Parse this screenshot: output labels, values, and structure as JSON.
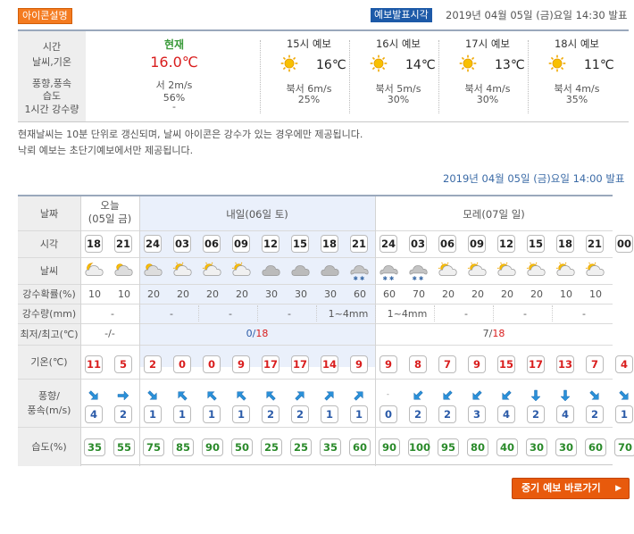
{
  "header": {
    "icon_label": "아이콘설명",
    "pub_label": "예보발표시각",
    "pub_time": "2019년 04월 05일 (금)요일 14:30 발표"
  },
  "current": {
    "head": [
      "시간",
      "날씨,기온",
      "풍향,풍속",
      "습도",
      "1시간 강수량"
    ],
    "now": {
      "label": "현재",
      "temp": "16.0℃",
      "wind": "서 2m/s",
      "humidity": "56%",
      "rain": "-"
    },
    "forecasts": [
      {
        "title": "15시 예보",
        "temp": "16℃",
        "wind": "북서 6m/s",
        "pop": "25%"
      },
      {
        "title": "16시 예보",
        "temp": "14℃",
        "wind": "북서 5m/s",
        "pop": "30%"
      },
      {
        "title": "17시 예보",
        "temp": "13℃",
        "wind": "북서 4m/s",
        "pop": "30%"
      },
      {
        "title": "18시 예보",
        "temp": "11℃",
        "wind": "북서 4m/s",
        "pop": "35%"
      }
    ],
    "icon": "sun-icon"
  },
  "notes": [
    "현재날씨는 10분 단위로 갱신되며, 날씨 아이콘은 강수가 있는 경우에만 제공됩니다.",
    "낙뢰 예보는 초단기예보에서만 제공됩니다."
  ],
  "forecast_time": "2019년 04월 05일 (금)요일 14:00 발표",
  "grid": {
    "row_labels": {
      "date": "날짜",
      "time": "시각",
      "weather": "날씨",
      "pop": "강수확률(%)",
      "rain": "강수량(mm)",
      "minmax": "최저/최고(℃)",
      "temp": "기온(℃)",
      "wind": "풍향/\n풍속(m/s)",
      "humidity": "습도(%)"
    },
    "days": {
      "today_line1": "오늘",
      "today_line2": "(05일 금)",
      "tomorrow": "내일(06일 토)",
      "dayafter": "모레(07일 일)"
    },
    "hours": [
      "18",
      "21",
      "24",
      "03",
      "06",
      "09",
      "12",
      "15",
      "18",
      "21",
      "24",
      "03",
      "06",
      "09",
      "12",
      "15",
      "18",
      "21",
      "00"
    ],
    "weather_icons": [
      "partly-cloudy-night-icon",
      "mostly-cloudy-icon",
      "mostly-cloudy-icon",
      "partly-cloudy-icon",
      "partly-cloudy-icon",
      "partly-cloudy-icon",
      "cloudy-icon",
      "cloudy-icon",
      "cloudy-icon",
      "rain-snow-icon",
      "rain-snow-icon",
      "rain-snow-icon",
      "partly-cloudy-icon",
      "partly-cloudy-icon",
      "partly-cloudy-icon",
      "partly-cloudy-icon",
      "partly-cloudy-icon",
      "partly-cloudy-icon"
    ],
    "pop": [
      "10",
      "10",
      "20",
      "20",
      "20",
      "20",
      "30",
      "30",
      "30",
      "60",
      "60",
      "70",
      "20",
      "20",
      "20",
      "20",
      "10",
      "10"
    ],
    "rain": [
      "-",
      "-",
      "-",
      "-",
      "1~4mm",
      "1~4mm",
      "-",
      "-",
      "-"
    ],
    "minmax": {
      "today": "-/-",
      "tomorrow_min": "0/",
      "tomorrow_max": "18",
      "dayafter_min": "7/",
      "dayafter_max": "18"
    },
    "temps": [
      "11",
      "5",
      "2",
      "0",
      "0",
      "9",
      "17",
      "17",
      "14",
      "9",
      "9",
      "8",
      "7",
      "9",
      "15",
      "17",
      "13",
      "7",
      "4"
    ],
    "wind_speeds": [
      "4",
      "2",
      "1",
      "1",
      "1",
      "1",
      "2",
      "2",
      "1",
      "1",
      "0",
      "2",
      "2",
      "3",
      "4",
      "2",
      "4",
      "2",
      "1"
    ],
    "wind_dirs": [
      135,
      90,
      135,
      315,
      315,
      315,
      315,
      45,
      45,
      45,
      -1,
      225,
      225,
      225,
      225,
      180,
      180,
      135,
      135
    ],
    "humidity": [
      "35",
      "55",
      "75",
      "85",
      "90",
      "50",
      "25",
      "25",
      "35",
      "60",
      "90",
      "100",
      "95",
      "80",
      "40",
      "30",
      "30",
      "60",
      "70"
    ]
  },
  "button": {
    "label": "중기 예보 바로가기",
    "chev": "▶"
  },
  "colors": {
    "orange": "#f47b20",
    "blue": "#1d5aa8",
    "red": "#d91d1d",
    "green": "#2a8a2a",
    "shade": "#eaf0fb"
  }
}
